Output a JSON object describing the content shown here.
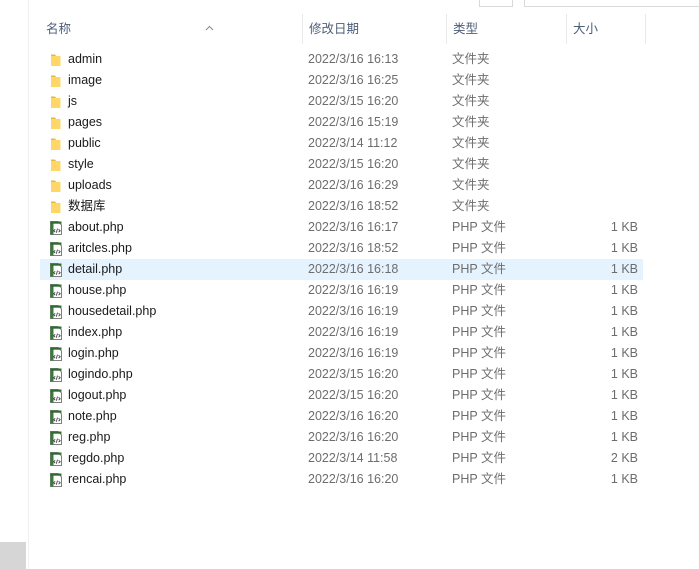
{
  "colors": {
    "folder": "#ffd768",
    "folder_tab": "#eab73c",
    "selected_row": "#e5f3ff",
    "header_text": "#4d5e78",
    "meta_text": "#6d6d6d"
  },
  "header": {
    "name": "名称",
    "date": "修改日期",
    "type": "类型",
    "size": "大小",
    "sorted_column": "name",
    "sort_icon": "sort-up-icon"
  },
  "files": [
    {
      "name": "admin",
      "date": "2022/3/16 16:13",
      "type": "文件夹",
      "size": "",
      "icon": "folder-icon"
    },
    {
      "name": "image",
      "date": "2022/3/16 16:25",
      "type": "文件夹",
      "size": "",
      "icon": "folder-icon"
    },
    {
      "name": "js",
      "date": "2022/3/15 16:20",
      "type": "文件夹",
      "size": "",
      "icon": "folder-icon"
    },
    {
      "name": "pages",
      "date": "2022/3/16 15:19",
      "type": "文件夹",
      "size": "",
      "icon": "folder-icon"
    },
    {
      "name": "public",
      "date": "2022/3/14 11:12",
      "type": "文件夹",
      "size": "",
      "icon": "folder-icon"
    },
    {
      "name": "style",
      "date": "2022/3/15 16:20",
      "type": "文件夹",
      "size": "",
      "icon": "folder-icon"
    },
    {
      "name": "uploads",
      "date": "2022/3/16 16:29",
      "type": "文件夹",
      "size": "",
      "icon": "folder-icon"
    },
    {
      "name": "数据库",
      "date": "2022/3/16 18:52",
      "type": "文件夹",
      "size": "",
      "icon": "folder-icon"
    },
    {
      "name": "about.php",
      "date": "2022/3/16 16:17",
      "type": "PHP 文件",
      "size": "1 KB",
      "icon": "php-file-icon"
    },
    {
      "name": "aritcles.php",
      "date": "2022/3/16 18:52",
      "type": "PHP 文件",
      "size": "1 KB",
      "icon": "php-file-icon"
    },
    {
      "name": "detail.php",
      "date": "2022/3/16 16:18",
      "type": "PHP 文件",
      "size": "1 KB",
      "icon": "php-file-icon",
      "selected": true
    },
    {
      "name": "house.php",
      "date": "2022/3/16 16:19",
      "type": "PHP 文件",
      "size": "1 KB",
      "icon": "php-file-icon"
    },
    {
      "name": "housedetail.php",
      "date": "2022/3/16 16:19",
      "type": "PHP 文件",
      "size": "1 KB",
      "icon": "php-file-icon"
    },
    {
      "name": "index.php",
      "date": "2022/3/16 16:19",
      "type": "PHP 文件",
      "size": "1 KB",
      "icon": "php-file-icon"
    },
    {
      "name": "login.php",
      "date": "2022/3/16 16:19",
      "type": "PHP 文件",
      "size": "1 KB",
      "icon": "php-file-icon"
    },
    {
      "name": "logindo.php",
      "date": "2022/3/15 16:20",
      "type": "PHP 文件",
      "size": "1 KB",
      "icon": "php-file-icon"
    },
    {
      "name": "logout.php",
      "date": "2022/3/15 16:20",
      "type": "PHP 文件",
      "size": "1 KB",
      "icon": "php-file-icon"
    },
    {
      "name": "note.php",
      "date": "2022/3/16 16:20",
      "type": "PHP 文件",
      "size": "1 KB",
      "icon": "php-file-icon"
    },
    {
      "name": "reg.php",
      "date": "2022/3/16 16:20",
      "type": "PHP 文件",
      "size": "1 KB",
      "icon": "php-file-icon"
    },
    {
      "name": "regdo.php",
      "date": "2022/3/14 11:58",
      "type": "PHP 文件",
      "size": "2 KB",
      "icon": "php-file-icon"
    },
    {
      "name": "rencai.php",
      "date": "2022/3/16 16:20",
      "type": "PHP 文件",
      "size": "1 KB",
      "icon": "php-file-icon"
    }
  ]
}
